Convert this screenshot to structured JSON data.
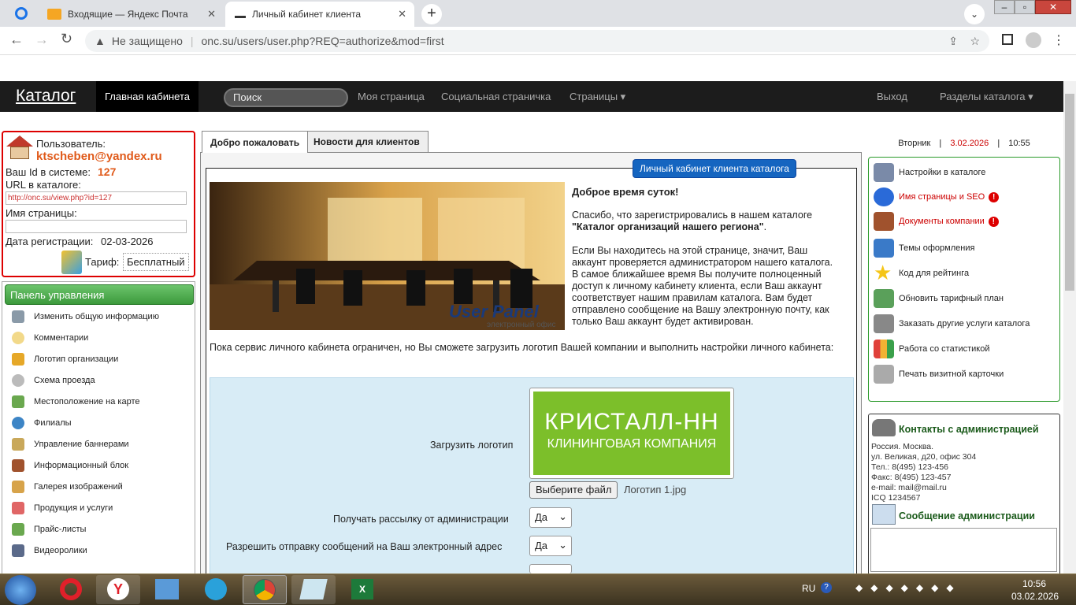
{
  "browser": {
    "tabs": [
      {
        "title": "Входящие — Яндекс Почта",
        "active": false
      },
      {
        "title": "Личный кабинет клиента",
        "active": true
      }
    ],
    "address": {
      "security": "Не защищено",
      "url": "onc.su/users/user.php?REQ=authorize&mod=first"
    }
  },
  "nav": {
    "brand": "Каталог",
    "home": "Главная кабинета",
    "search_placeholder": "Поиск",
    "my_page": "Моя страница",
    "social": "Социальная страничка",
    "pages": "Страницы",
    "exit": "Выход",
    "sections": "Разделы каталога"
  },
  "user": {
    "user_label": "Пользователь:",
    "email": "ktscheben@yandex.ru",
    "id_label": "Ваш Id в системе:",
    "id": "127",
    "url_label": "URL в каталоге:",
    "url": "http://onc.su/view.php?id=127",
    "page_name_label": "Имя страницы:",
    "page_name": "",
    "reg_label": "Дата регистрации:",
    "reg_date": "02-03-2026",
    "tariff_label": "Тариф:",
    "tariff": "Бесплатный"
  },
  "panel": {
    "title": "Панель управления",
    "items": [
      "Изменить общую информацию",
      "Комментарии",
      "Логотип организации",
      "Схема проезда",
      "Местоположение на карте",
      "Филиалы",
      "Управление баннерами",
      "Информационный блок",
      "Галерея изображений",
      "Продукция и услуги",
      "Прайс-листы",
      "Видеоролики"
    ]
  },
  "center": {
    "tab_welcome": "Добро пожаловать",
    "tab_news": "Новости для клиентов",
    "badge": "Личный кабинет клиента каталога",
    "photo_caption": "User Panel",
    "photo_subcaption": "электронный офис",
    "greeting": "Доброе время суток!",
    "thanks": "Спасибо, что зарегистрировались в нашем каталоге",
    "catalog_name": "\"Каталог организаций нашего региона\"",
    "verification": "Если Вы находитесь на этой странице, значит, Ваш аккаунт проверяется администратором нашего каталога. В самое ближайшее время Вы получите полноценный доступ к личному кабинету клиента, если Ваш аккаунт соответствует нашим правилам каталога. Вам будет отправлено сообщение на Вашу электронную почту, как только Ваш аккаунт будет активирован.",
    "limited": "Пока сервис личного кабинета ограничен, но Вы сможете загрузить логотип Вашей компании и выполнить настройки личного кабинета:",
    "form": {
      "upload_label": "Загрузить логотип",
      "logo_line1": "КРИСТАЛЛ-НН",
      "logo_line2": "КЛИНИНГОВАЯ КОМПАНИЯ",
      "choose_file": "Выберите файл",
      "file_name": "Логотип 1.jpg",
      "mailing_label": "Получать рассылку от администрации",
      "mailing_value": "Да",
      "allow_label": "Разрешить отправку сообщений на Ваш электронный адрес",
      "allow_value": "Да"
    }
  },
  "right": {
    "weekday": "Вторник",
    "date": "3.02.2026",
    "time": "10:55",
    "items": [
      {
        "label": "Настройки в каталоге",
        "warn": false
      },
      {
        "label": "Имя страницы и SEO",
        "warn": true
      },
      {
        "label": "Документы компании",
        "warn": true
      },
      {
        "label": "Темы оформления",
        "warn": false
      },
      {
        "label": "Код для рейтинга",
        "warn": false
      },
      {
        "label": "Обновить тарифный план",
        "warn": false
      },
      {
        "label": "Заказать другие услуги каталога",
        "warn": false
      },
      {
        "label": "Работа со статистикой",
        "warn": false
      },
      {
        "label": "Печать визитной карточки",
        "warn": false
      }
    ],
    "contacts_title": "Контакты с администрацией",
    "contacts": [
      "Россия. Москва.",
      "ул. Великая, д20, офис 304",
      "Тел.: 8(495) 123-456",
      "Факс: 8(495) 123-457",
      "e-mail: mail@mail.ru",
      "ICQ 1234567"
    ],
    "message_title": "Сообщение администрации"
  },
  "taskbar": {
    "lang": "RU",
    "time": "10:56",
    "date": "03.02.2026"
  },
  "colors": {
    "accent_green": "#3c9a3c",
    "warn_red": "#d00000",
    "badge_blue": "#1565c0"
  }
}
